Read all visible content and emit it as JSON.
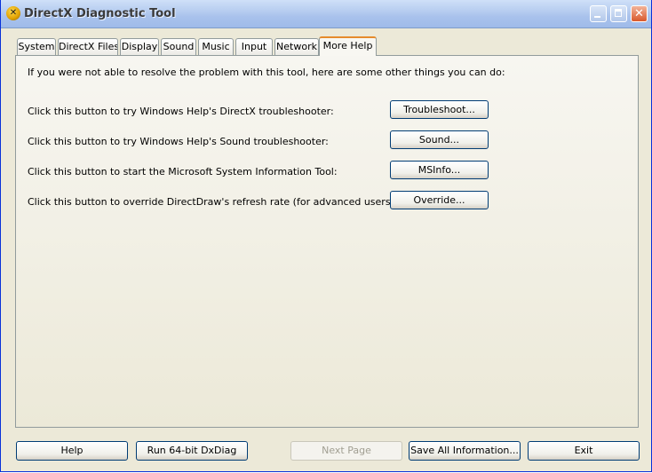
{
  "window": {
    "title": "DirectX Diagnostic Tool",
    "icon": "directx-icon",
    "controls": {
      "minimize": "minimize-icon",
      "maximize": "maximize-icon",
      "close": "close-icon"
    }
  },
  "tabs": [
    {
      "label": "System",
      "active": false
    },
    {
      "label": "DirectX Files",
      "active": false
    },
    {
      "label": "Display",
      "active": false
    },
    {
      "label": "Sound",
      "active": false
    },
    {
      "label": "Music",
      "active": false
    },
    {
      "label": "Input",
      "active": false
    },
    {
      "label": "Network",
      "active": false
    },
    {
      "label": "More Help",
      "active": true
    }
  ],
  "more_help": {
    "intro": "If you were not able to resolve the problem with this tool, here are some other things you can do:",
    "rows": [
      {
        "label": "Click this button to try Windows Help's DirectX troubleshooter:",
        "button": "Troubleshoot..."
      },
      {
        "label": "Click this button to try Windows Help's Sound troubleshooter:",
        "button": "Sound..."
      },
      {
        "label": "Click this button to start the Microsoft System Information Tool:",
        "button": "MSInfo..."
      },
      {
        "label": "Click this button to override DirectDraw's refresh rate (for advanced users only):",
        "button": "Override..."
      }
    ]
  },
  "bottom_buttons": {
    "help": "Help",
    "run64": "Run 64-bit DxDiag",
    "next_page": "Next Page",
    "save_all": "Save All Information...",
    "exit": "Exit"
  },
  "colors": {
    "window_face": "#ece9d8",
    "active_tab_accent": "#e68b2c",
    "button_border": "#003c74",
    "disabled_text": "#a19f92"
  }
}
